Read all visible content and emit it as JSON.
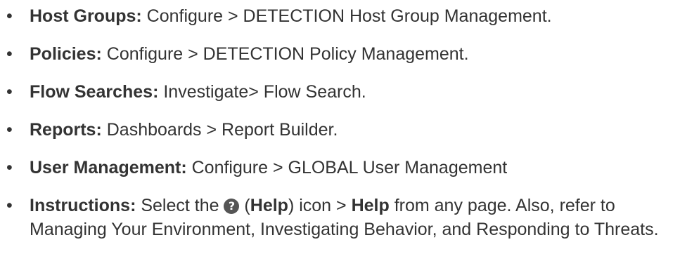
{
  "items": [
    {
      "term": "Host Groups:",
      "text": " Configure > DETECTION Host Group Management."
    },
    {
      "term": "Policies:",
      "text": " Configure > DETECTION Policy Management."
    },
    {
      "term": "Flow Searches:",
      "text": " Investigate> Flow Search."
    },
    {
      "term": "Reports:",
      "text": " Dashboards > Report Builder."
    },
    {
      "term": "User Management:",
      "text": " Configure > GLOBAL User Management"
    }
  ],
  "instructions": {
    "term": "Instructions:",
    "pre_icon": " Select the ",
    "icon_glyph": "?",
    "icon_name": "help-icon",
    "paren_open": " (",
    "help_word": "Help",
    "after_help": ") icon > ",
    "help_word_2": "Help",
    "rest": " from any page. Also, refer to Managing Your Environment, Investigating Behavior, and Responding to Threats."
  },
  "bullet": "•"
}
